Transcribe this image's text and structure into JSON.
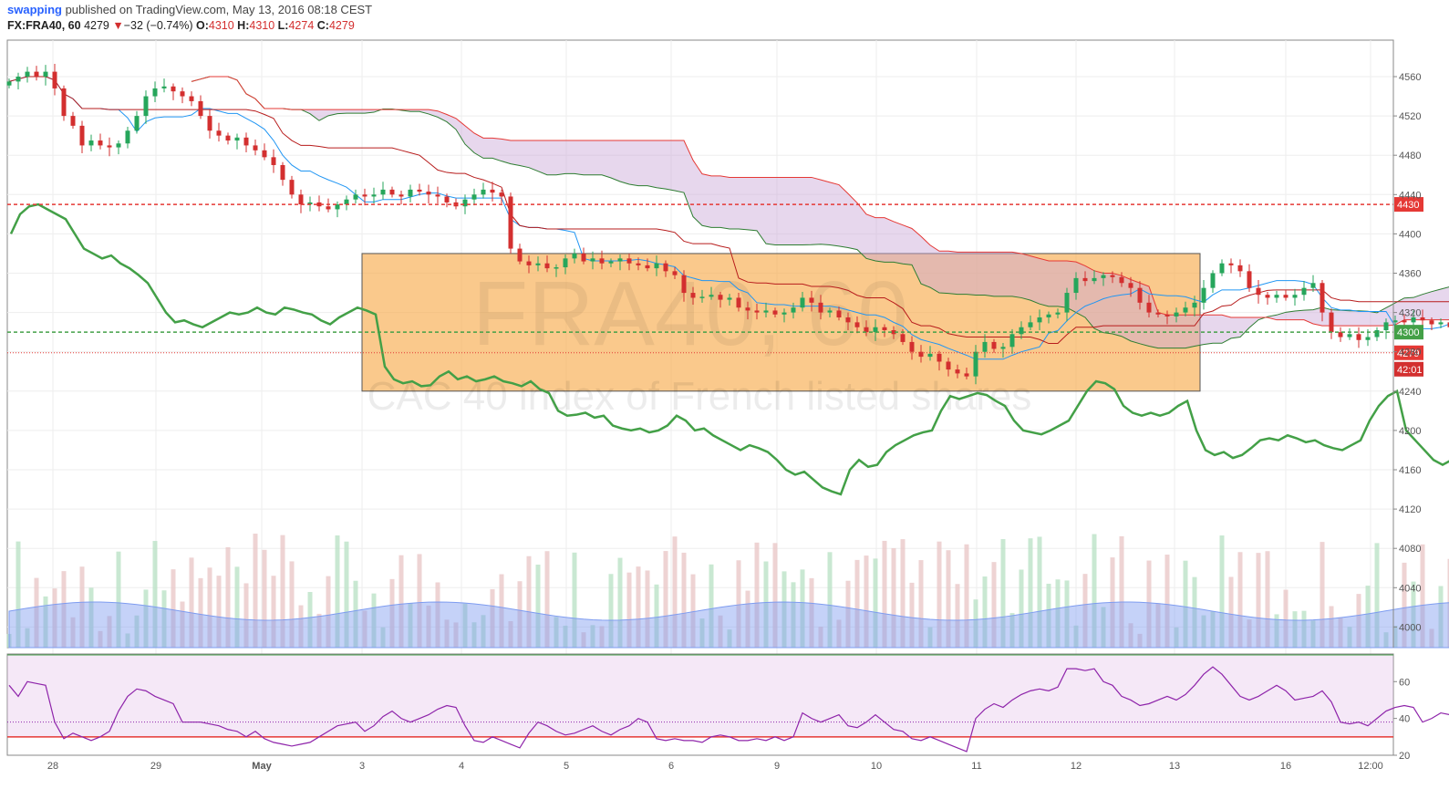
{
  "header": {
    "user": "swapping",
    "published_text": "published on TradingView.com, May 13, 2016 08:18 CEST",
    "symbol": "FX:FRA40, 60",
    "last": "4279",
    "change": "−32 (−0.74%)",
    "o_label": "O:",
    "o_value": "4310",
    "h_label": "H:",
    "h_value": "4310",
    "l_label": "L:",
    "l_value": "4274",
    "c_label": "C:",
    "c_value": "4279"
  },
  "watermark": {
    "symbol": "FRA40, 60",
    "description": "CAC 40 index of French listed shares"
  },
  "colors": {
    "up": "#26a65b",
    "down": "#d32f2f",
    "kumo": "#c9a7d8",
    "tenkan": "#2196f3",
    "kijun": "#b71c1c",
    "chikou": "#43a047",
    "box": "#f7a845",
    "rsi": "#8e24aa"
  },
  "price_tags": [
    {
      "value": 4430,
      "label": "4430",
      "color": "#e53935"
    },
    {
      "value": 4300,
      "label": "4300",
      "color": "#43a047"
    },
    {
      "value": 4279,
      "label": "4279",
      "color": "#e53935"
    }
  ],
  "countdown": "42:01",
  "chart_data": {
    "type": "candlestick",
    "y_ticks": [
      4000,
      4040,
      4080,
      4120,
      4160,
      4200,
      4240,
      4280,
      4320,
      4360,
      4400,
      4440,
      4480,
      4520,
      4560
    ],
    "x_labels": [
      "28",
      "29",
      "May",
      "3",
      "4",
      "5",
      "6",
      "9",
      "10",
      "11",
      "12",
      "13",
      "16",
      "12:00"
    ],
    "levels": {
      "resistance": 4430,
      "support": 4300,
      "last": 4279
    },
    "range_box": {
      "from": "3",
      "to": "13",
      "high": 4380,
      "low": 4240
    },
    "closes": [
      4555,
      4560,
      4565,
      4560,
      4565,
      4548,
      4520,
      4510,
      4490,
      4495,
      4490,
      4488,
      4492,
      4505,
      4520,
      4540,
      4548,
      4550,
      4545,
      4540,
      4535,
      4520,
      4505,
      4500,
      4495,
      4498,
      4490,
      4485,
      4478,
      4470,
      4455,
      4440,
      4430,
      4432,
      4428,
      4425,
      4430,
      4435,
      4440,
      4438,
      4440,
      4445,
      4440,
      4438,
      4445,
      4443,
      4440,
      4438,
      4432,
      4428,
      4435,
      4440,
      4445,
      4442,
      4438,
      4385,
      4372,
      4368,
      4370,
      4365,
      4366,
      4375,
      4380,
      4372,
      4375,
      4370,
      4372,
      4375,
      4370,
      4368,
      4365,
      4370,
      4362,
      4358,
      4340,
      4335,
      4336,
      4338,
      4333,
      4335,
      4325,
      4322,
      4320,
      4322,
      4318,
      4320,
      4325,
      4335,
      4330,
      4320,
      4322,
      4315,
      4310,
      4305,
      4300,
      4305,
      4302,
      4298,
      4290,
      4280,
      4275,
      4278,
      4270,
      4262,
      4258,
      4255,
      4280,
      4290,
      4283,
      4285,
      4298,
      4305,
      4310,
      4315,
      4318,
      4320,
      4340,
      4355,
      4352,
      4355,
      4358,
      4356,
      4350,
      4345,
      4330,
      4320,
      4318,
      4316,
      4320,
      4325,
      4330,
      4345,
      4360,
      4370,
      4368,
      4362,
      4345,
      4338,
      4335,
      4338,
      4335,
      4338,
      4345,
      4350,
      4320,
      4300,
      4295,
      4298,
      4292,
      4295,
      4302,
      4310,
      4312,
      4310,
      4315,
      4312,
      4308,
      4310,
      4305,
      4302,
      4300,
      4305,
      4310,
      4330,
      4345,
      4355,
      4360,
      4320,
      4310,
      4300,
      4290,
      4285,
      4290,
      4300,
      4310,
      4315,
      4312,
      4279
    ],
    "rsi": {
      "ylim": [
        20,
        75
      ],
      "ticks": [
        20,
        40,
        60
      ],
      "oversold": 30,
      "values": [
        58,
        52,
        60,
        59,
        58,
        38,
        29,
        32,
        30,
        28,
        30,
        33,
        44,
        52,
        56,
        55,
        52,
        50,
        48,
        38,
        38,
        38,
        37,
        36,
        34,
        33,
        30,
        33,
        29,
        27,
        26,
        25,
        26,
        27,
        30,
        33,
        36,
        37,
        38,
        33,
        36,
        41,
        44,
        40,
        38,
        40,
        42,
        45,
        47,
        46,
        36,
        28,
        27,
        30,
        28,
        26,
        24,
        32,
        38,
        36,
        33,
        31,
        32,
        34,
        36,
        33,
        31,
        34,
        36,
        40,
        38,
        29,
        28,
        29,
        28,
        28,
        27,
        30,
        31,
        30,
        28,
        28,
        29,
        28,
        30,
        28,
        30,
        43,
        40,
        38,
        40,
        42,
        36,
        35,
        38,
        42,
        38,
        34,
        33,
        29,
        28,
        30,
        28,
        26,
        24,
        22,
        40,
        45,
        48,
        46,
        50,
        53,
        55,
        56,
        55,
        57,
        67,
        67,
        66,
        67,
        60,
        58,
        52,
        50,
        47,
        48,
        50,
        52,
        50,
        53,
        58,
        64,
        68,
        64,
        58,
        52,
        50,
        52,
        55,
        58,
        55,
        50,
        51,
        52,
        55,
        49,
        38,
        37,
        38,
        36,
        40,
        44,
        46,
        47,
        46,
        38,
        40,
        43,
        42,
        44,
        39,
        38,
        40,
        59,
        65,
        66,
        63,
        57,
        45,
        42,
        40,
        42,
        45,
        50,
        48,
        38
      ]
    }
  }
}
